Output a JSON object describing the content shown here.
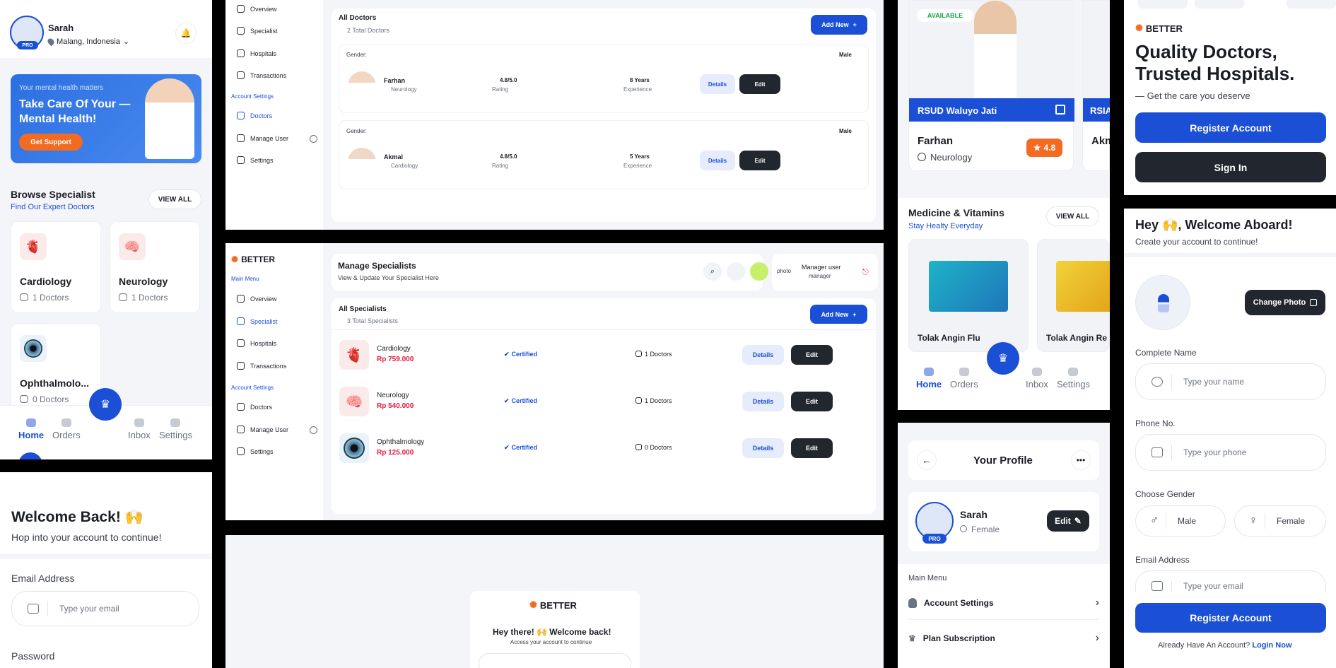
{
  "home": {
    "user_name": "Sarah",
    "user_location": "Malang, Indonesia",
    "pro_badge": "PRO",
    "banner_small": "Your mental health matters",
    "banner_title": "Take Care Of Your — Mental Health!",
    "banner_button": "Get Support",
    "browse_title": "Browse Specialist",
    "browse_subtitle": "Find Our Expert Doctors",
    "view_all": "VIEW ALL",
    "specialists": [
      {
        "name": "Cardiology",
        "count": "1 Doctors"
      },
      {
        "name": "Neurology",
        "count": "1 Doctors"
      },
      {
        "name": "Ophthalmolo...",
        "count": "0 Doctors"
      }
    ],
    "nav": [
      "Home",
      "Orders",
      "Inbox",
      "Settings"
    ]
  },
  "signin": {
    "title": "Welcome Back! 🙌",
    "subtitle": "Hop into your account to continue!",
    "email_label": "Email Address",
    "email_placeholder": "Type your email",
    "password_label": "Password"
  },
  "doctors_admin": {
    "sidebar": [
      "Overview",
      "Specialist",
      "Hospitals",
      "Transactions",
      "Account Settings",
      "Doctors",
      "Manage User",
      "Settings"
    ],
    "title": "All Doctors",
    "total": "2 Total Doctors",
    "add_new": "Add New",
    "gender_label": "Gender:",
    "rating_label": "Rating",
    "experience_label": "Experience",
    "details": "Details",
    "edit": "Edit",
    "doctors": [
      {
        "name": "Farhan",
        "specialty": "Neurology",
        "gender": "Male",
        "rating": "4.8/5.0",
        "experience": "8 Years"
      },
      {
        "name": "Akmal",
        "specialty": "Cardiology",
        "gender": "Male",
        "rating": "4.8/5.0",
        "experience": "5 Years"
      }
    ]
  },
  "specialists_admin": {
    "brand": "BETTER",
    "main_menu": "Main Menu",
    "sidebar": [
      "Overview",
      "Specialist",
      "Hospitals",
      "Transactions",
      "Account Settings",
      "Doctors",
      "Manage User",
      "Settings"
    ],
    "page_title": "Manage Specialists",
    "page_subtitle": "View & Update Your Specialist Here",
    "user_name": "Manager user",
    "user_role": "manager",
    "photo_alt": "photo",
    "list_title": "All Specialists",
    "list_total": "3 Total Specialists",
    "add_new": "Add New",
    "details": "Details",
    "edit": "Edit",
    "certified": "Certified",
    "items": [
      {
        "name": "Cardiology",
        "price": "Rp 759.000",
        "doctors": "1 Doctors"
      },
      {
        "name": "Neurology",
        "price": "Rp 540.000",
        "doctors": "1 Doctors"
      },
      {
        "name": "Ophthalmology",
        "price": "Rp 125.000",
        "doctors": "0 Doctors"
      }
    ]
  },
  "login_admin": {
    "brand": "BETTER",
    "title": "Hey there! 🙌 Welcome back!",
    "subtitle": "Access your account to continue"
  },
  "doctor_detail": {
    "available": "AVAILABLE",
    "hospital": "RSUD Waluyo Jati",
    "hospital2": "RSIA",
    "doctor_name": "Farhan",
    "doctor_name2": "Akm",
    "specialty": "Neurology",
    "rating": "4.8",
    "medicine_title": "Medicine & Vitamins",
    "medicine_subtitle": "Stay Healty Everyday",
    "view_all": "VIEW ALL",
    "products": [
      "Tolak Angin Flu",
      "Tolak Angin Re"
    ],
    "nav": [
      "Home",
      "Orders",
      "Inbox",
      "Settings"
    ]
  },
  "profile": {
    "title": "Your Profile",
    "name": "Sarah",
    "gender": "Female",
    "pro": "PRO",
    "edit": "Edit",
    "main_menu": "Main Menu",
    "menu": [
      "Account Settings",
      "Plan Subscription"
    ]
  },
  "onboarding": {
    "brand": "BETTER",
    "headline": "Quality Doctors, Trusted Hospitals.",
    "tagline": "— Get the care you deserve",
    "register": "Register Account",
    "signin": "Sign In"
  },
  "signup": {
    "title": "Hey 🙌, Welcome Aboard!",
    "subtitle": "Create your account to continue!",
    "change_photo": "Change Photo",
    "name_label": "Complete Name",
    "name_placeholder": "Type your name",
    "phone_label": "Phone No.",
    "phone_placeholder": "Type your phone",
    "gender_label": "Choose Gender",
    "male": "Male",
    "female": "Female",
    "email_label": "Email Address",
    "email_placeholder": "Type your email",
    "register": "Register Account",
    "already": "Already Have An Account?",
    "login": "Login Now"
  },
  "colors": {
    "primary": "#1a4fd6",
    "dark": "#22262e",
    "price": "#e5173f",
    "orange": "#f26b21"
  }
}
